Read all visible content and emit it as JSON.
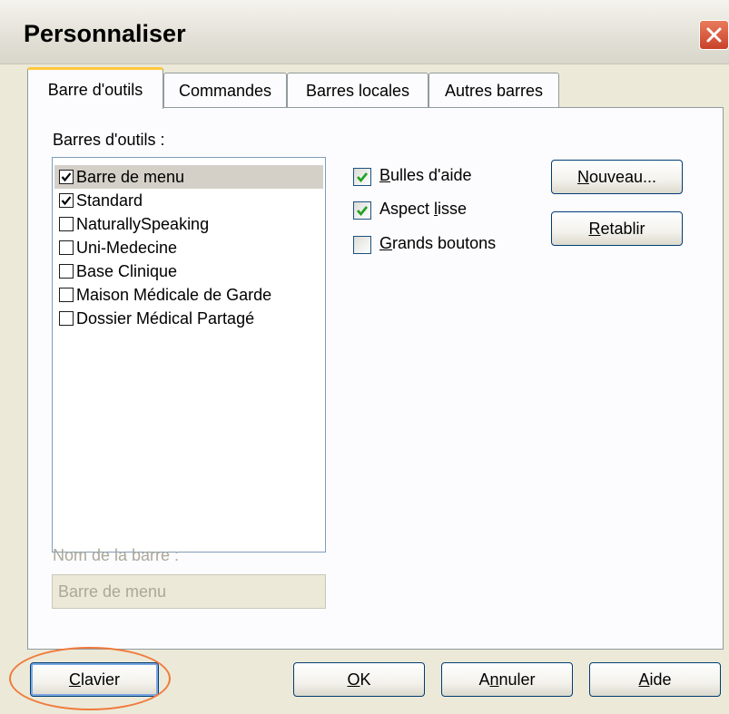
{
  "window": {
    "title": "Personnaliser"
  },
  "tabs": [
    {
      "label": "Barre d'outils"
    },
    {
      "label": "Commandes"
    },
    {
      "label": "Barres locales"
    },
    {
      "label": "Autres barres"
    }
  ],
  "toolbars": {
    "label": "Barres d'outils :",
    "items": [
      {
        "label": "Barre de menu",
        "checked": true
      },
      {
        "label": "Standard",
        "checked": true
      },
      {
        "label": "NaturallySpeaking",
        "checked": false
      },
      {
        "label": "Uni-Medecine",
        "checked": false
      },
      {
        "label": "Base Clinique",
        "checked": false
      },
      {
        "label": "Maison Médicale de Garde",
        "checked": false
      },
      {
        "label": "Dossier Médical Partagé",
        "checked": false
      }
    ]
  },
  "options": {
    "bulles": {
      "first": "B",
      "rest": "ulles d'aide",
      "checked": true
    },
    "aspect": {
      "first": "Aspect ",
      "ul": "l",
      "rest": "isse",
      "checked": true
    },
    "grands": {
      "first": "G",
      "rest": "rands boutons",
      "checked": false
    }
  },
  "buttons": {
    "nouveau": {
      "first": "N",
      "rest": "ouveau..."
    },
    "retablir": {
      "first": "R",
      "rest": "etablir"
    },
    "clavier": {
      "first": "C",
      "rest": "lavier"
    },
    "ok": {
      "first": "O",
      "rest": "K"
    },
    "annuler": {
      "first": "A",
      "ul": "n",
      "rest": "nuler"
    },
    "aide": {
      "first": "A",
      "rest": "ide"
    }
  },
  "bar_name": {
    "label": "Nom de la barre :",
    "value": "Barre de menu"
  },
  "colors": {
    "highlight": "#f07a3c",
    "check": "#21a121",
    "selected_row": "#d4d0c8"
  }
}
